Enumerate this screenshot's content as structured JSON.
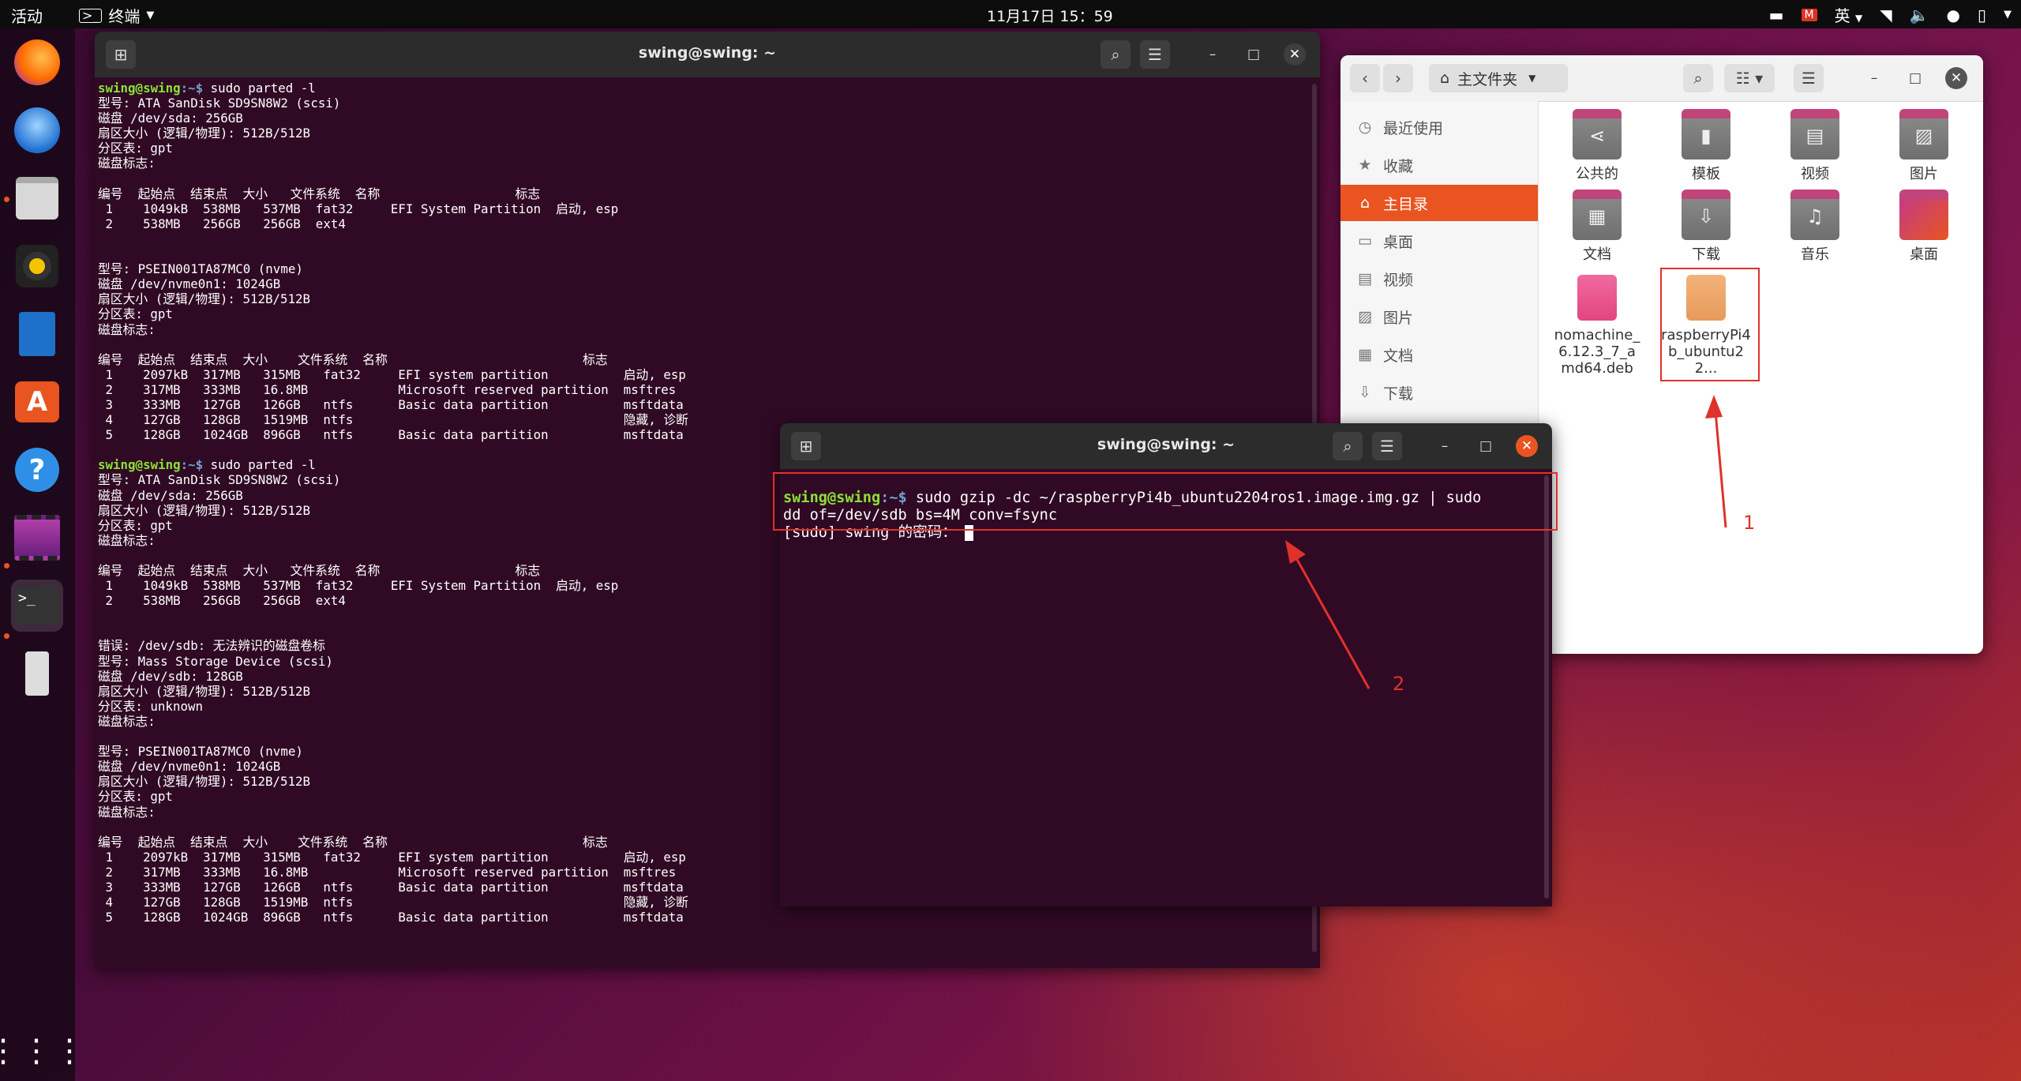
{
  "topbar": {
    "activities": "活动",
    "app_name": "终端",
    "clock": "11月17日  15：59",
    "ime": "英"
  },
  "dock": {
    "items": [
      "firefox-icon",
      "thunderbird-icon",
      "files-icon",
      "rhythmbox-icon",
      "writer-icon",
      "app-center-icon",
      "help-icon",
      "video-editor-icon",
      "terminal-icon",
      "usb-drive-icon"
    ],
    "show_apps": "show-apps-icon"
  },
  "term1": {
    "title": "swing@swing: ~",
    "prompt_user": "swing@swing",
    "prompt_sep": ":~$ ",
    "lines": [
      {
        "prompt": true,
        "cmd": "sudo parted -l"
      },
      {
        "text": "型号: ATA SanDisk SD9SN8W2 (scsi)"
      },
      {
        "text": "磁盘 /dev/sda: 256GB"
      },
      {
        "text": "扇区大小 (逻辑/物理): 512B/512B"
      },
      {
        "text": "分区表: gpt"
      },
      {
        "text": "磁盘标志:"
      },
      {
        "text": ""
      },
      {
        "text": "编号  起始点  结束点  大小   文件系统  名称                  标志"
      },
      {
        "text": " 1    1049kB  538MB   537MB  fat32     EFI System Partition  启动, esp"
      },
      {
        "text": " 2    538MB   256GB   256GB  ext4"
      },
      {
        "text": ""
      },
      {
        "text": ""
      },
      {
        "text": "型号: PSEIN001TA87MC0 (nvme)"
      },
      {
        "text": "磁盘 /dev/nvme0n1: 1024GB"
      },
      {
        "text": "扇区大小 (逻辑/物理): 512B/512B"
      },
      {
        "text": "分区表: gpt"
      },
      {
        "text": "磁盘标志:"
      },
      {
        "text": ""
      },
      {
        "text": "编号  起始点  结束点  大小    文件系统  名称                          标志"
      },
      {
        "text": " 1    2097kB  317MB   315MB   fat32     EFI system partition          启动, esp"
      },
      {
        "text": " 2    317MB   333MB   16.8MB            Microsoft reserved partition  msftres"
      },
      {
        "text": " 3    333MB   127GB   126GB   ntfs      Basic data partition          msftdata"
      },
      {
        "text": " 4    127GB   128GB   1519MB  ntfs                                    隐藏, 诊断"
      },
      {
        "text": " 5    128GB   1024GB  896GB   ntfs      Basic data partition          msftdata"
      },
      {
        "text": ""
      },
      {
        "prompt": true,
        "cmd": "sudo parted -l"
      },
      {
        "text": "型号: ATA SanDisk SD9SN8W2 (scsi)"
      },
      {
        "text": "磁盘 /dev/sda: 256GB"
      },
      {
        "text": "扇区大小 (逻辑/物理): 512B/512B"
      },
      {
        "text": "分区表: gpt"
      },
      {
        "text": "磁盘标志:"
      },
      {
        "text": ""
      },
      {
        "text": "编号  起始点  结束点  大小   文件系统  名称                  标志"
      },
      {
        "text": " 1    1049kB  538MB   537MB  fat32     EFI System Partition  启动, esp"
      },
      {
        "text": " 2    538MB   256GB   256GB  ext4"
      },
      {
        "text": ""
      },
      {
        "text": ""
      },
      {
        "text": "错误: /dev/sdb: 无法辨识的磁盘卷标"
      },
      {
        "text": "型号: Mass Storage Device (scsi)"
      },
      {
        "text": "磁盘 /dev/sdb: 128GB"
      },
      {
        "text": "扇区大小 (逻辑/物理): 512B/512B"
      },
      {
        "text": "分区表: unknown"
      },
      {
        "text": "磁盘标志:"
      },
      {
        "text": ""
      },
      {
        "text": "型号: PSEIN001TA87MC0 (nvme)"
      },
      {
        "text": "磁盘 /dev/nvme0n1: 1024GB"
      },
      {
        "text": "扇区大小 (逻辑/物理): 512B/512B"
      },
      {
        "text": "分区表: gpt"
      },
      {
        "text": "磁盘标志:"
      },
      {
        "text": ""
      },
      {
        "text": "编号  起始点  结束点  大小    文件系统  名称                          标志"
      },
      {
        "text": " 1    2097kB  317MB   315MB   fat32     EFI system partition          启动, esp"
      },
      {
        "text": " 2    317MB   333MB   16.8MB            Microsoft reserved partition  msftres"
      },
      {
        "text": " 3    333MB   127GB   126GB   ntfs      Basic data partition          msftdata"
      },
      {
        "text": " 4    127GB   128GB   1519MB  ntfs                                    隐藏, 诊断"
      },
      {
        "text": " 5    128GB   1024GB  896GB   ntfs      Basic data partition          msftdata"
      }
    ]
  },
  "term2": {
    "title": "swing@swing: ~",
    "prompt_user": "swing@swing",
    "prompt_sep": ":~$ ",
    "cmd_line1": "sudo gzip -dc ~/raspberryPi4b_ubuntu2204ros1.image.img.gz | sudo",
    "cmd_line2": "dd of=/dev/sdb bs=4M conv=fsync",
    "password_prompt": "[sudo] swing 的密码："
  },
  "files": {
    "location": "主文件夹",
    "sidebar": [
      {
        "icon": "clock-icon",
        "label": "最近使用"
      },
      {
        "icon": "star-icon",
        "label": "收藏"
      },
      {
        "icon": "home-icon",
        "label": "主目录"
      },
      {
        "icon": "desktop-icon",
        "label": "桌面"
      },
      {
        "icon": "video-icon",
        "label": "视频"
      },
      {
        "icon": "picture-icon",
        "label": "图片"
      },
      {
        "icon": "document-icon",
        "label": "文档"
      },
      {
        "icon": "download-icon",
        "label": "下载"
      }
    ],
    "items": [
      {
        "label": "公共的",
        "icon": "share-folder-icon"
      },
      {
        "label": "模板",
        "icon": "template-folder-icon"
      },
      {
        "label": "视频",
        "icon": "video-folder-icon"
      },
      {
        "label": "图片",
        "icon": "picture-folder-icon"
      },
      {
        "label": "文档",
        "icon": "document-folder-icon"
      },
      {
        "label": "下载",
        "icon": "download-folder-icon"
      },
      {
        "label": "音乐",
        "icon": "music-folder-icon"
      },
      {
        "label": "桌面",
        "icon": "desktop-folder-icon"
      },
      {
        "label": "nomachine_6.12.3_7_amd64.deb",
        "icon": "deb-package-icon"
      },
      {
        "label": "raspberryPi4b_ubuntu22...",
        "icon": "archive-icon"
      }
    ]
  },
  "annotations": {
    "label1": "1",
    "label2": "2",
    "color": "#e0322a"
  },
  "colors": {
    "accent": "#e95420",
    "terminal_bg": "#300a24",
    "prompt_user": "#8ae234",
    "prompt_path": "#729fcf"
  }
}
